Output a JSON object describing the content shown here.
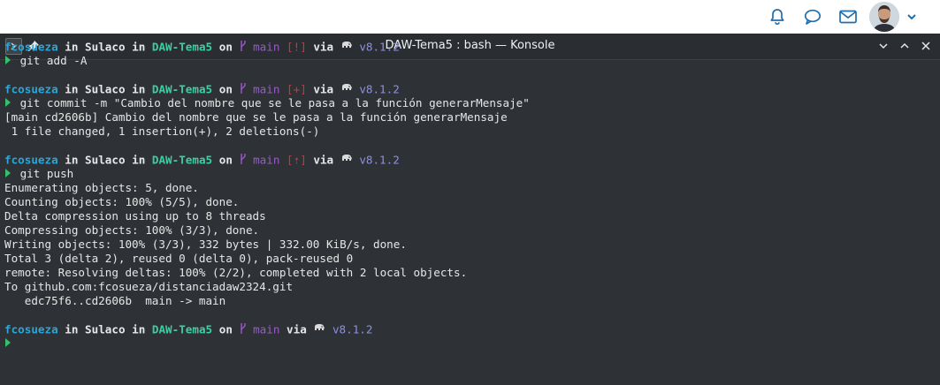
{
  "window": {
    "title": "DAW-Tema5 : bash — Konsole"
  },
  "prompt": {
    "user": "fcosueza",
    "in": "in",
    "host": "Sulaco",
    "dir": "DAW-Tema5",
    "on": "on",
    "branch": "main",
    "via": "via",
    "node_version": "v8.1.2"
  },
  "blocks": [
    {
      "status": "[!]",
      "command": "git add -A",
      "output": []
    },
    {
      "status": "[+]",
      "command": "git commit -m \"Cambio del nombre que se le pasa a la función generarMensaje\"",
      "output": [
        "[main cd2606b] Cambio del nombre que se le pasa a la función generarMensaje",
        " 1 file changed, 1 insertion(+), 2 deletions(-)"
      ]
    },
    {
      "status": "[⇡]",
      "command": "git push",
      "output": [
        "Enumerating objects: 5, done.",
        "Counting objects: 100% (5/5), done.",
        "Delta compression using up to 8 threads",
        "Compressing objects: 100% (3/3), done.",
        "Writing objects: 100% (3/3), 332 bytes | 332.00 KiB/s, done.",
        "Total 3 (delta 2), reused 0 (delta 0), pack-reused 0",
        "remote: Resolving deltas: 100% (2/2), completed with 2 local objects.",
        "To github.com:fcosueza/distanciadaw2324.git",
        "   edc75f6..cd2606b  main -> main"
      ]
    },
    {
      "status": "",
      "command": "",
      "output": []
    }
  ],
  "icons": {
    "bell": "bell-icon",
    "chat": "chat-icon",
    "mail": "mail-icon",
    "branch": "git-branch-icon",
    "node": "elephant-icon",
    "prompt": "prompt-chevron-icon"
  },
  "colors": {
    "terminal_bg": "#2e3236",
    "user": "#2aa7d8",
    "directory": "#3fcfa0",
    "branch": "#9a59c9",
    "status": "#c23b3b",
    "version": "#8e8fe6",
    "prompt_arrow": "#35c06a",
    "topbar_icon": "#1f6fb0"
  }
}
